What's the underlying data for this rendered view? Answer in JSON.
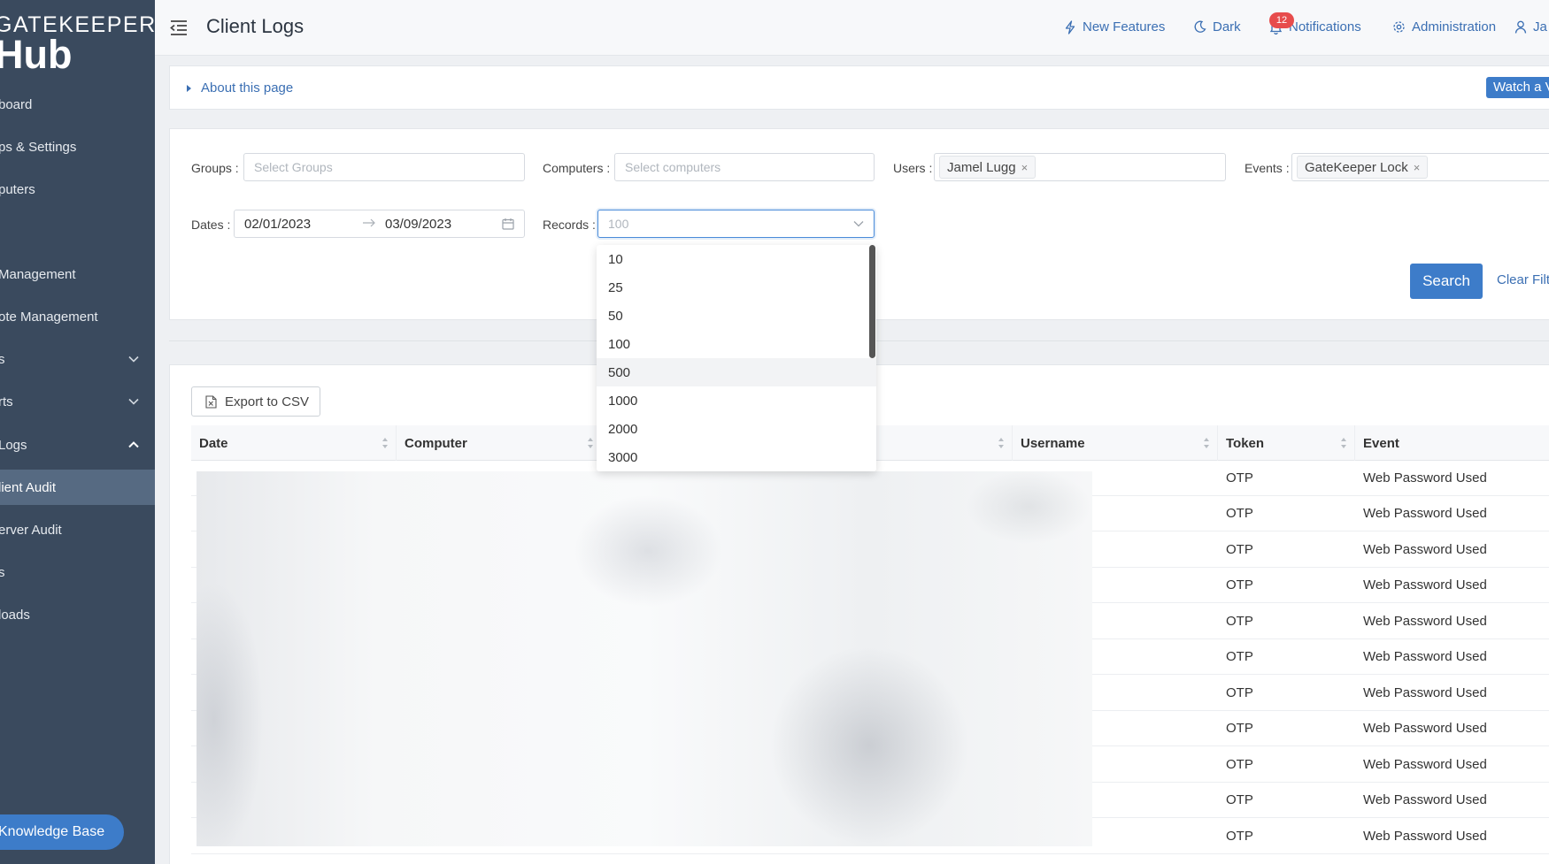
{
  "sidebar": {
    "logo_line1": "GATEKEEPER",
    "logo_line2": "Hub",
    "items": [
      {
        "label": "board"
      },
      {
        "label": "ps & Settings"
      },
      {
        "label": "puters"
      },
      {
        "label": ""
      },
      {
        "label": "Management"
      },
      {
        "label": "ote Management"
      },
      {
        "label": "s"
      },
      {
        "label": "rts"
      },
      {
        "label": " Logs"
      },
      {
        "label": "lient Audit"
      },
      {
        "label": "erver Audit"
      },
      {
        "label": "s"
      },
      {
        "label": "loads"
      }
    ],
    "knowledge_base": "Knowledge Base"
  },
  "header": {
    "title": "Client Logs",
    "new_features": "New Features",
    "dark": "Dark",
    "notifications": "Notifications",
    "notif_count": "12",
    "administration": "Administration",
    "user": "Ja"
  },
  "about": {
    "label": "About this page",
    "watch": "Watch a Video"
  },
  "filters": {
    "groups_label": "Groups",
    "groups_placeholder": "Select Groups",
    "computers_label": "Computers",
    "computers_placeholder": "Select computers",
    "users_label": "Users",
    "users_tag": "Jamel Lugg",
    "events_label": "Events",
    "events_tag": "GateKeeper Lock",
    "dates_label": "Dates",
    "date_from": "02/01/2023",
    "date_to": "03/09/2023",
    "records_label": "Records",
    "records_value": "100",
    "search": "Search",
    "clear": "Clear Filters"
  },
  "records_dropdown": {
    "options": [
      "10",
      "25",
      "50",
      "100",
      "500",
      "1000",
      "2000",
      "3000"
    ],
    "hovered": "500"
  },
  "table": {
    "export": "Export to CSV",
    "columns": [
      "Date",
      "Computer",
      "",
      "",
      "Username",
      "Token",
      "Event"
    ],
    "rows": [
      {
        "token": "OTP",
        "event": "Web Password Used"
      },
      {
        "token": "OTP",
        "event": "Web Password Used"
      },
      {
        "token": "OTP",
        "event": "Web Password Used"
      },
      {
        "token": "OTP",
        "event": "Web Password Used"
      },
      {
        "token": "OTP",
        "event": "Web Password Used"
      },
      {
        "token": "OTP",
        "event": "Web Password Used"
      },
      {
        "token": "OTP",
        "event": "Web Password Used"
      },
      {
        "token": "OTP",
        "event": "Web Password Used"
      },
      {
        "token": "OTP",
        "event": "Web Password Used"
      },
      {
        "token": "OTP",
        "event": "Web Password Used"
      },
      {
        "token": "OTP",
        "event": "Web Password Used"
      }
    ]
  },
  "colors": {
    "sidebar_bg": "#3a4a5e",
    "sidebar_active": "#566a82",
    "accent": "#3d7cc9",
    "link": "#3b6fb3",
    "badge": "#e74c4c"
  }
}
